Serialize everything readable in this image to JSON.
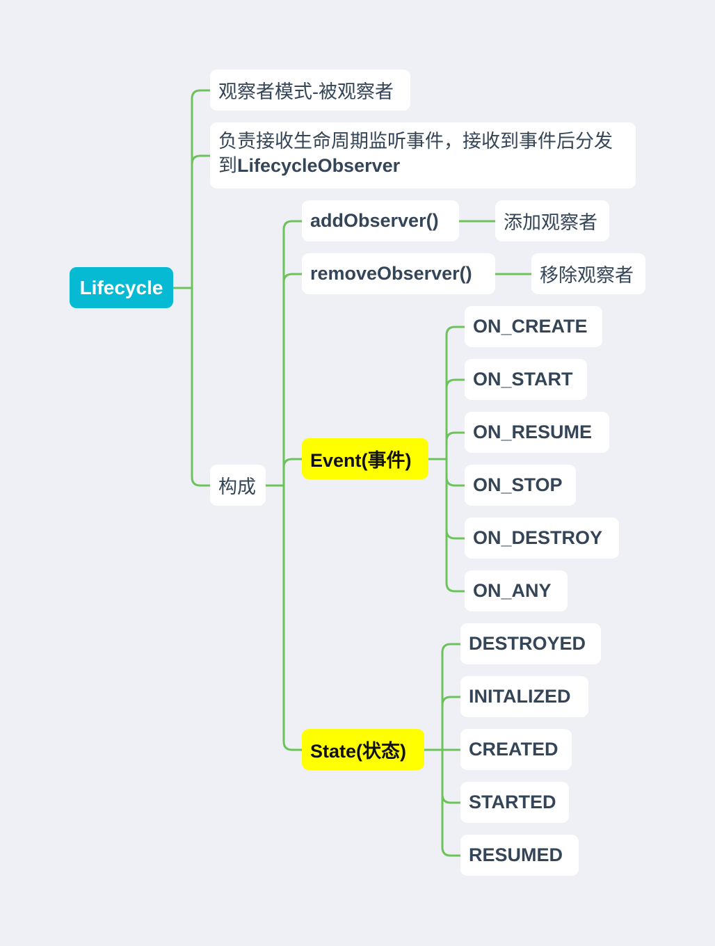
{
  "colors": {
    "background": "#eef0f5",
    "root": "#06bad3",
    "highlight": "#ffff00",
    "connector": "#6cc35a",
    "text": "#344558"
  },
  "root": {
    "label": "Lifecycle"
  },
  "branches": {
    "pattern": {
      "label": "观察者模式-被观察者"
    },
    "responsibility": {
      "label_line1": "负责接收生命周期监听事件，接收到事件后分发",
      "label_prefix": "到",
      "label_bold": "LifecycleObserver"
    },
    "composition": {
      "label": "构成",
      "add_observer": {
        "label": "addObserver()",
        "note": "添加观察者"
      },
      "remove_observer": {
        "label": "removeObserver()",
        "note": "移除观察者"
      },
      "event": {
        "label": "Event(事件)",
        "items": [
          "ON_CREATE",
          "ON_START",
          "ON_RESUME",
          "ON_STOP",
          "ON_DESTROY",
          "ON_ANY"
        ]
      },
      "state": {
        "label": "State(状态)",
        "items": [
          "DESTROYED",
          "INITALIZED",
          "CREATED",
          "STARTED",
          "RESUMED"
        ]
      }
    }
  }
}
